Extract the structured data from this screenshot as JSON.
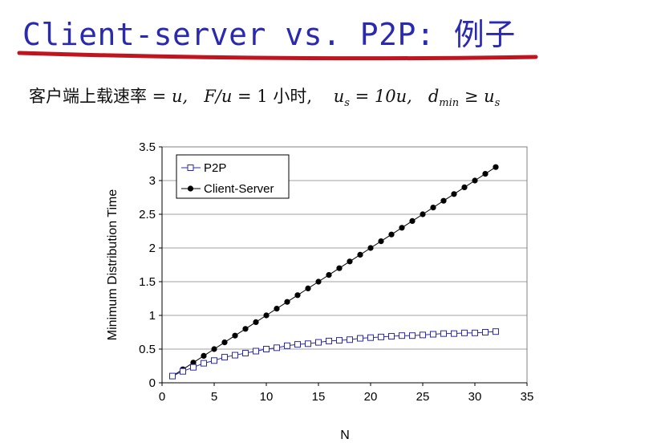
{
  "slide": {
    "title": "Client-server vs. P2P: 例子",
    "subtitle": {
      "lead": "客户端上载速率 = ",
      "u1": "u,",
      "mid1": "F/u",
      "mid2": " = 1 小时,",
      "us": "u",
      "us_sub": "s",
      "eq2": " = 10u,",
      "d": "d",
      "d_sub": "min",
      "ge": " ≥ ",
      "u2": "u",
      "u2_sub": "s"
    },
    "accent_color": "#2a2ab0",
    "underline_color": "#c0141e"
  },
  "chart_data": {
    "type": "line",
    "xlabel": "N",
    "ylabel": "Minimum Distribution Time",
    "xlim": [
      0,
      35
    ],
    "ylim": [
      0,
      3.5
    ],
    "xticks": [
      "0",
      "5",
      "10",
      "15",
      "20",
      "25",
      "30",
      "35"
    ],
    "yticks": [
      "0",
      "0.5",
      "1",
      "1.5",
      "2",
      "2.5",
      "3",
      "3.5"
    ],
    "grid": "horizontal",
    "legend_position": "top-left",
    "x": [
      1,
      2,
      3,
      4,
      5,
      6,
      7,
      8,
      9,
      10,
      11,
      12,
      13,
      14,
      15,
      16,
      17,
      18,
      19,
      20,
      21,
      22,
      23,
      24,
      25,
      26,
      27,
      28,
      29,
      30,
      31,
      32
    ],
    "series": [
      {
        "name": "P2P",
        "color": "#2a2ab0",
        "marker": "open-square",
        "values": [
          0.1,
          0.17,
          0.23,
          0.29,
          0.33,
          0.38,
          0.41,
          0.44,
          0.47,
          0.5,
          0.52,
          0.55,
          0.57,
          0.58,
          0.6,
          0.62,
          0.63,
          0.64,
          0.66,
          0.67,
          0.68,
          0.69,
          0.7,
          0.7,
          0.71,
          0.72,
          0.73,
          0.73,
          0.74,
          0.74,
          0.75,
          0.76
        ]
      },
      {
        "name": "Client-Server",
        "color": "#000000",
        "marker": "filled-circle",
        "values": [
          0.1,
          0.2,
          0.3,
          0.4,
          0.5,
          0.6,
          0.7,
          0.8,
          0.9,
          1.0,
          1.1,
          1.2,
          1.3,
          1.4,
          1.5,
          1.6,
          1.7,
          1.8,
          1.9,
          2.0,
          2.1,
          2.2,
          2.3,
          2.4,
          2.5,
          2.6,
          2.7,
          2.8,
          2.9,
          3.0,
          3.1,
          3.2
        ]
      }
    ]
  }
}
